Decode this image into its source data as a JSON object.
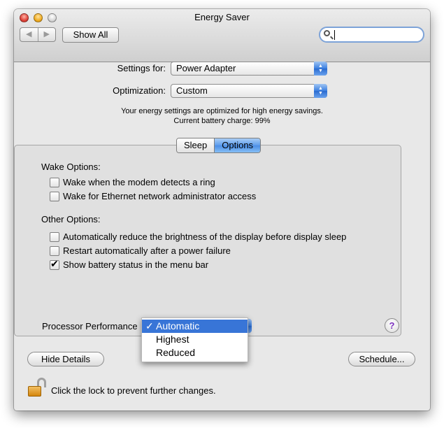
{
  "window": {
    "title": "Energy Saver"
  },
  "toolbar": {
    "show_all_label": "Show All",
    "search_value": ""
  },
  "settings": {
    "settings_for_label": "Settings for:",
    "settings_for_value": "Power Adapter",
    "optimization_label": "Optimization:",
    "optimization_value": "Custom",
    "info_line1": "Your energy settings are optimized for high energy savings.",
    "info_line2": "Current battery charge: 99%"
  },
  "tabs": [
    {
      "label": "Sleep",
      "active": false
    },
    {
      "label": "Options",
      "active": true
    }
  ],
  "options": {
    "wake_header": "Wake Options:",
    "wake_items": [
      {
        "label": "Wake when the modem detects a ring",
        "checked": false
      },
      {
        "label": "Wake for Ethernet network administrator access",
        "checked": false
      }
    ],
    "other_header": "Other Options:",
    "other_items": [
      {
        "label": "Automatically reduce the brightness of the display before display sleep",
        "checked": false
      },
      {
        "label": "Restart automatically after a power failure",
        "checked": false
      },
      {
        "label": "Show battery status in the menu bar",
        "checked": true
      }
    ],
    "processor_label": "Processor Performance",
    "processor_menu": {
      "items": [
        "Automatic",
        "Highest",
        "Reduced"
      ],
      "selected": "Automatic",
      "check_glyph": "✓"
    }
  },
  "buttons": {
    "hide_details": "Hide Details",
    "schedule": "Schedule...",
    "help": "?"
  },
  "lock": {
    "text": "Click the lock to prevent further changes."
  }
}
